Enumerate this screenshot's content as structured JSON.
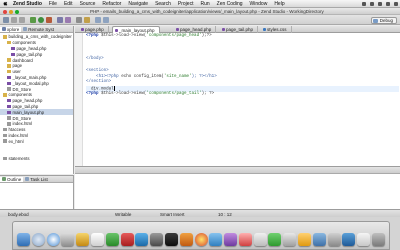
{
  "menubar": {
    "app": "Zend Studio",
    "items": [
      "File",
      "Edit",
      "Source",
      "Refactor",
      "Navigate",
      "Search",
      "Project",
      "Run",
      "Zen Coding",
      "Window",
      "Help"
    ]
  },
  "window": {
    "title": "PHP - emails_building_a_cms_with_codeigniter/application/views/_main_layout.php - Zend Studio - WorkingDirectory"
  },
  "toolbar": {
    "perspective_label": "Debug"
  },
  "left_panel": {
    "tabs": [
      "xplore",
      "Remote Syst"
    ],
    "tree": [
      {
        "label": "building_a_cms_with_codeigniter",
        "indent": 0,
        "icon": "folder"
      },
      {
        "label": "components",
        "indent": 1,
        "icon": "folder"
      },
      {
        "label": "page_head.php",
        "indent": 2,
        "icon": "php"
      },
      {
        "label": "page_tail.php",
        "indent": 2,
        "icon": "php"
      },
      {
        "label": "dashboard",
        "indent": 1,
        "icon": "folder"
      },
      {
        "label": "page",
        "indent": 1,
        "icon": "folder"
      },
      {
        "label": "user",
        "indent": 1,
        "icon": "folder"
      },
      {
        "label": "_layout_main.php",
        "indent": 1,
        "icon": "php"
      },
      {
        "label": "_layout_modal.php",
        "indent": 1,
        "icon": "php"
      },
      {
        "label": "DS_Store",
        "indent": 1,
        "icon": "file"
      },
      {
        "label": "components",
        "indent": 0,
        "icon": "folder"
      },
      {
        "label": "page_head.php",
        "indent": 1,
        "icon": "php"
      },
      {
        "label": "page_tail.php",
        "indent": 1,
        "icon": "php"
      },
      {
        "label": "main_layout.php",
        "indent": 1,
        "icon": "php",
        "selected": true
      },
      {
        "label": "DS_Store",
        "indent": 1,
        "icon": "file"
      },
      {
        "label": "index.html",
        "indent": 1,
        "icon": "file"
      },
      {
        "label": "htaccess",
        "indent": 0,
        "icon": "file"
      },
      {
        "label": "index.html",
        "indent": 0,
        "icon": "file"
      },
      {
        "label": "ex_html",
        "indent": 0,
        "icon": "file"
      },
      {
        "label": "",
        "indent": 0,
        "icon": "none"
      },
      {
        "label": "",
        "indent": 0,
        "icon": "none"
      },
      {
        "label": "statements",
        "indent": 0,
        "icon": "file"
      }
    ],
    "bottom_tabs": [
      "Outline",
      "Task List"
    ]
  },
  "editor": {
    "tabs": [
      {
        "label": "page.php",
        "active": false
      },
      {
        "label": "_main_layout.php",
        "active": true
      },
      {
        "label": "page_head.php",
        "active": false
      },
      {
        "label": "page_tail.php",
        "active": false
      },
      {
        "label": "styles.css",
        "active": false
      }
    ],
    "code_lines": [
      {
        "parts": [
          {
            "t": "<?php ",
            "c": "php"
          },
          {
            "t": "$this->load->view(",
            "c": ""
          },
          {
            "t": "'components/page_head'",
            "c": "str"
          },
          {
            "t": ");?>",
            "c": ""
          }
        ]
      },
      {
        "parts": []
      },
      {
        "parts": []
      },
      {
        "parts": []
      },
      {
        "parts": [
          {
            "t": "</body>",
            "c": "tag"
          }
        ]
      },
      {
        "parts": []
      },
      {
        "parts": [
          {
            "t": "<section>",
            "c": "tag"
          }
        ]
      },
      {
        "parts": [
          {
            "t": "    <h1><?php ",
            "c": "tag"
          },
          {
            "t": "echo config_item(",
            "c": ""
          },
          {
            "t": "'site_name'",
            "c": "str"
          },
          {
            "t": "); ?></h1>",
            "c": "tag"
          }
        ]
      },
      {
        "parts": [
          {
            "t": "</section>",
            "c": "tag"
          }
        ]
      },
      {
        "parts": [
          {
            "t": "  div.",
            "c": ""
          },
          {
            "t": "modal",
            "c": ""
          }
        ],
        "cursor": true
      },
      {
        "parts": [
          {
            "t": "<?php ",
            "c": "php"
          },
          {
            "t": "$this->load->view(",
            "c": ""
          },
          {
            "t": "'components/page_tail'",
            "c": "str"
          },
          {
            "t": "); ?>",
            "c": ""
          }
        ]
      }
    ]
  },
  "status_bar": {
    "mode": "Writable",
    "insert": "Smart Insert",
    "position": "10 : 12",
    "breadcrumb": "body.ebod"
  },
  "colors": {
    "selection": "#c7d5e8",
    "php_keyword": "#1f3fa8",
    "string": "#2a7a2a",
    "current_line": "#e8f2fe"
  }
}
